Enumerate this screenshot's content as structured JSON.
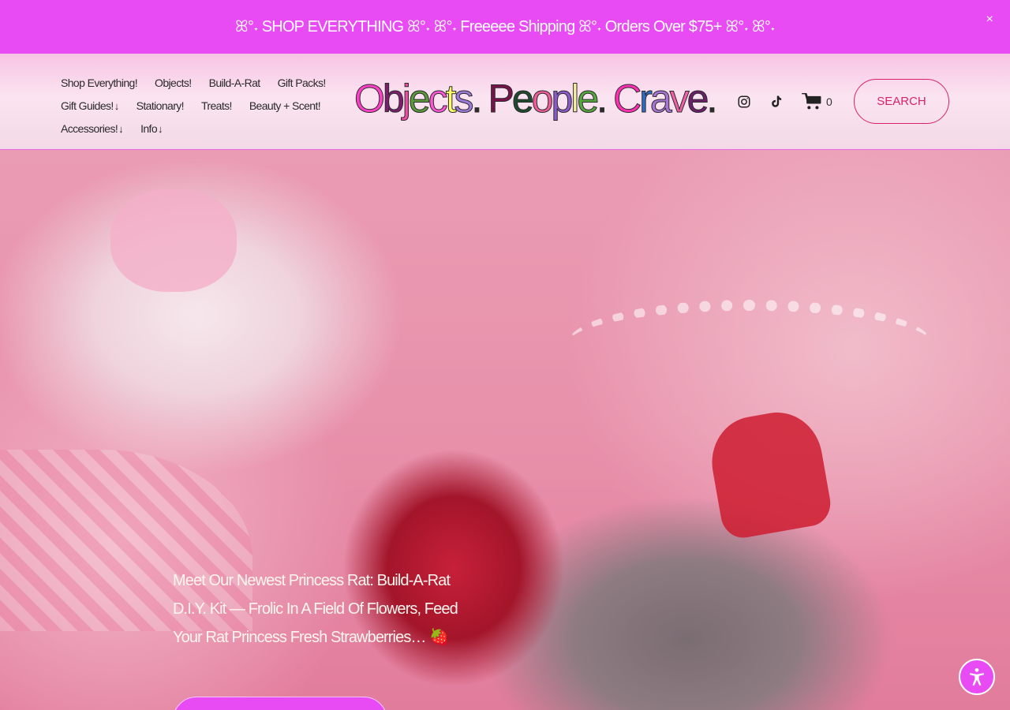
{
  "announcement": {
    "text": "ꕤ°˖ SHOP EVERYTHING ꕤ°˖ ꕤ°˖ Freeeee Shipping ꕤ°˖ Orders Over $75+ ꕤ°˖ ꕤ°˖",
    "close": "×"
  },
  "nav": {
    "row1": [
      "Shop Everything!",
      "Objects!",
      "Build-A-Rat",
      "Gift Packs!"
    ],
    "row2": [
      "Gift Guides!",
      "Stationary!",
      "Treats!",
      "Beauty + Scent!"
    ],
    "row3": [
      "Accessories!",
      "Info"
    ],
    "dropdown_arrow": "↓"
  },
  "logo": {
    "letters": [
      {
        "ch": "O",
        "color": "#ff3fc8"
      },
      {
        "ch": "b",
        "color": "#7f1d6f"
      },
      {
        "ch": "j",
        "color": "#f04ba6"
      },
      {
        "ch": "e",
        "color": "#5a9a3a"
      },
      {
        "ch": "c",
        "color": "#ff55d6"
      },
      {
        "ch": "t",
        "color": "#ffff66"
      },
      {
        "ch": "s",
        "color": "#9c7ad9"
      },
      {
        "ch": ".",
        "color": "#2b2b2b"
      },
      {
        "ch": " ",
        "color": "#000"
      },
      {
        "ch": "P",
        "color": "#7a114d"
      },
      {
        "ch": "e",
        "color": "#1e4a2f"
      },
      {
        "ch": "o",
        "color": "#f15c9a"
      },
      {
        "ch": "p",
        "color": "#8a5acb"
      },
      {
        "ch": "l",
        "color": "#f7f0a0"
      },
      {
        "ch": "e",
        "color": "#56a83e"
      },
      {
        "ch": ".",
        "color": "#2b2b2b"
      },
      {
        "ch": " ",
        "color": "#000"
      },
      {
        "ch": "C",
        "color": "#ff2fb4"
      },
      {
        "ch": "r",
        "color": "#2e6cc9"
      },
      {
        "ch": "a",
        "color": "#a874d6"
      },
      {
        "ch": "v",
        "color": "#f35fa6"
      },
      {
        "ch": "e",
        "color": "#6c1f6a"
      },
      {
        "ch": ".",
        "color": "#2b2b2b"
      }
    ]
  },
  "header_icons": {
    "instagram": "instagram-icon",
    "tiktok": "tiktok-icon",
    "cart": "cart-icon",
    "cart_count": "0"
  },
  "search": {
    "label": "SEARCH"
  },
  "hero": {
    "caption": "Meet Our Newest Princess Rat: Build-A-Rat D.I.Y. Kit — Frolic In A Field Of Flowers, Feed Your Rat Princess Fresh Strawberries… 🍓"
  },
  "colors": {
    "accent": "#e84bf4",
    "search_border": "#d8236a"
  },
  "accessibility": {
    "icon": "accessibility-icon"
  }
}
